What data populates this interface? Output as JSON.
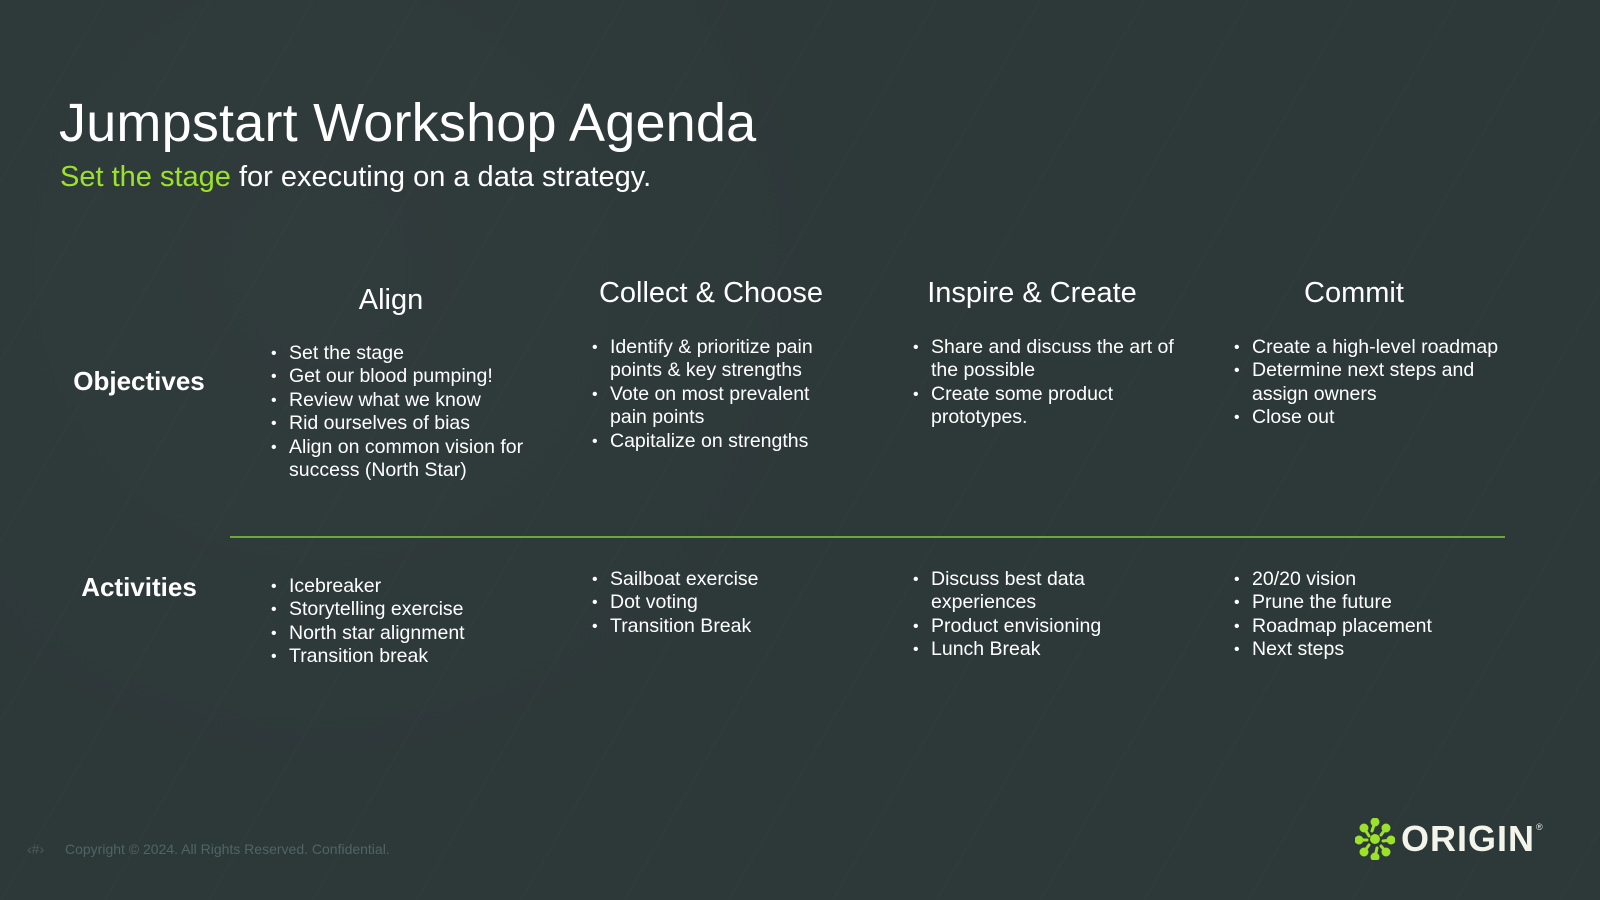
{
  "slide": {
    "title": "Jumpstart Workshop Agenda",
    "subtitle_accent": "Set the stage",
    "subtitle_rest": " for executing on a data strategy.",
    "accent_color": "#9be22a",
    "divider_color": "#6aa83a",
    "background_color": "#2d3839"
  },
  "rows": {
    "objectives_label": "Objectives",
    "activities_label": "Activities"
  },
  "columns": [
    {
      "heading": "Align",
      "objectives": [
        "Set the stage",
        "Get our blood pumping!",
        "Review what we know",
        "Rid ourselves of bias",
        "Align on common vision for success (North Star)"
      ],
      "activities": [
        "Icebreaker",
        "Storytelling exercise",
        "North star alignment",
        "Transition break"
      ]
    },
    {
      "heading": "Collect & Choose",
      "objectives": [
        "Identify & prioritize pain points & key strengths",
        "Vote on most prevalent pain points",
        "Capitalize on strengths"
      ],
      "activities": [
        "Sailboat exercise",
        "Dot voting",
        "Transition Break"
      ]
    },
    {
      "heading": "Inspire & Create",
      "objectives": [
        "Share and discuss the art of the possible",
        "Create some product prototypes."
      ],
      "activities": [
        "Discuss best data experiences",
        "Product envisioning",
        "Lunch Break"
      ]
    },
    {
      "heading": "Commit",
      "objectives": [
        "Create a high-level roadmap",
        "Determine next steps and assign owners",
        "Close out"
      ],
      "activities": [
        "20/20 vision",
        "Prune the future",
        "Roadmap placement",
        "Next steps"
      ]
    }
  ],
  "footer": {
    "slide_number_placeholder": "‹#›",
    "copyright": "Copyright © 2024. All Rights Reserved.  Confidential."
  },
  "logo": {
    "icon": "origin-dots-logo-icon",
    "wordmark": "ORIGIN",
    "registered": "®"
  }
}
